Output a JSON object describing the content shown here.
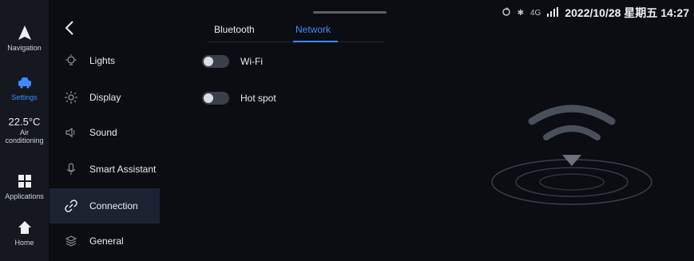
{
  "status": {
    "network": "4G",
    "datetime": "2022/10/28 星期五 14:27"
  },
  "rail": {
    "navigation": "Navigation",
    "settings": "Settings",
    "temperature": "22.5°C",
    "air": "Air conditioning",
    "applications": "Applications",
    "home": "Home"
  },
  "tabs": {
    "bluetooth": "Bluetooth",
    "network": "Network"
  },
  "menu": [
    {
      "label": "Lights"
    },
    {
      "label": "Display"
    },
    {
      "label": "Sound"
    },
    {
      "label": "Smart Assistant"
    },
    {
      "label": "Connection"
    },
    {
      "label": "General"
    }
  ],
  "network": {
    "wifi_label": "Wi-Fi",
    "wifi_on": false,
    "hotspot_label": "Hot spot",
    "hotspot_on": false
  },
  "colors": {
    "accent": "#3d8bff",
    "background": "#0b0d12"
  }
}
